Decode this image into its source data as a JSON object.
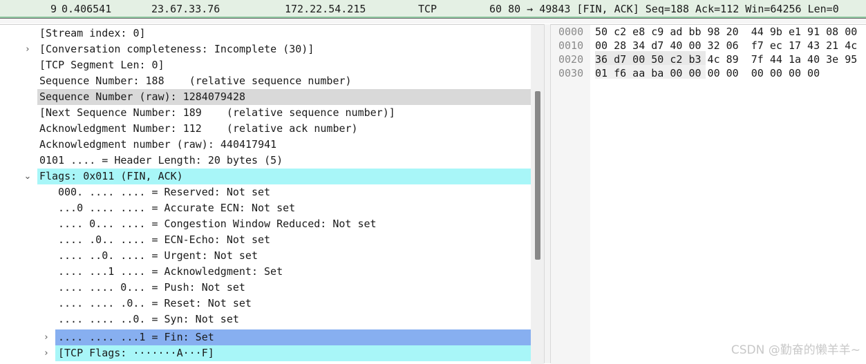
{
  "packet_list": {
    "no": "9",
    "time": "0.406541",
    "source": "23.67.33.76",
    "destination": "172.22.54.215",
    "protocol": "TCP",
    "info": "60 80 → 49843 [FIN, ACK] Seq=188 Ack=112 Win=64256 Len=0"
  },
  "tree": {
    "lines": [
      "[Stream index: 0]",
      "[Conversation completeness: Incomplete (30)]",
      "[TCP Segment Len: 0]",
      "Sequence Number: 188    (relative sequence number)",
      "Sequence Number (raw): 1284079428",
      "[Next Sequence Number: 189    (relative sequence number)]",
      "Acknowledgment Number: 112    (relative ack number)",
      "Acknowledgment number (raw): 440417941",
      "0101 .... = Header Length: 20 bytes (5)",
      "Flags: 0x011 (FIN, ACK)",
      "000. .... .... = Reserved: Not set",
      "...0 .... .... = Accurate ECN: Not set",
      ".... 0... .... = Congestion Window Reduced: Not set",
      ".... .0.. .... = ECN-Echo: Not set",
      ".... ..0. .... = Urgent: Not set",
      ".... ...1 .... = Acknowledgment: Set",
      ".... .... 0... = Push: Not set",
      ".... .... .0.. = Reset: Not set",
      ".... .... ..0. = Syn: Not set",
      ".... .... ...1 = Fin: Set",
      "[TCP Flags: ·······A···F]"
    ]
  },
  "hex": {
    "offsets": [
      "0000",
      "0010",
      "0020",
      "0030"
    ],
    "rows": [
      "50 c2 e8 c9 ad bb 98 20  44 9b e1 91 08 00",
      "00 28 34 d7 40 00 32 06  f7 ec 17 43 21 4c",
      "36 d7 00 50 c2 b3 4c 89  7f 44 1a 40 3e 95",
      "01 f6 aa ba 00 00 00 00  00 00 00 00"
    ]
  },
  "watermark": "CSDN @勤奋的懒羊羊~"
}
